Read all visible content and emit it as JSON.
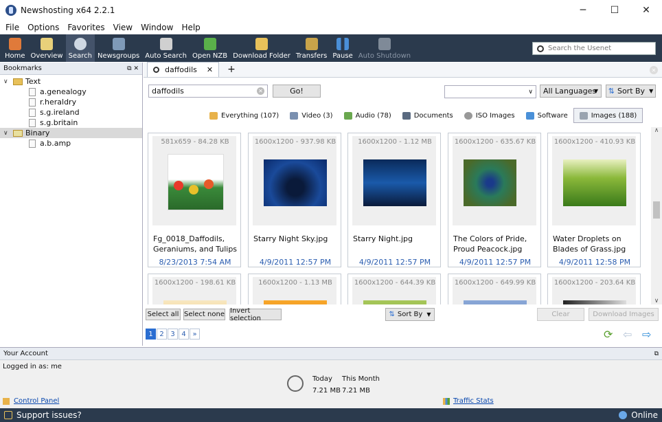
{
  "window": {
    "title": "Newshosting x64 2.2.1",
    "minimize": "─",
    "maximize": "☐",
    "close": "✕"
  },
  "menu": [
    "File",
    "Options",
    "Favorites",
    "View",
    "Window",
    "Help"
  ],
  "toolbar": [
    {
      "label": "Home",
      "icon": "home-icon",
      "color": "#e07a3a"
    },
    {
      "label": "Overview",
      "icon": "overview-icon",
      "color": "#e8d07a"
    },
    {
      "label": "Search",
      "icon": "search-icon",
      "color": "#cfd8e3"
    },
    {
      "label": "Newsgroups",
      "icon": "newsgroups-icon",
      "color": "#7f9ab8"
    },
    {
      "label": "Auto Search",
      "icon": "auto-search-icon",
      "color": "#d0d0d0"
    },
    {
      "label": "Open NZB",
      "icon": "open-nzb-icon",
      "color": "#5ab04a"
    },
    {
      "label": "Download Folder",
      "icon": "download-folder-icon",
      "color": "#e8c15a"
    },
    {
      "label": "Transfers",
      "icon": "transfers-icon",
      "color": "#c9a44a"
    },
    {
      "label": "Pause",
      "icon": "pause-icon",
      "color": "#4a8fd8"
    },
    {
      "label": "Auto Shutdown",
      "icon": "auto-shutdown-icon",
      "color": "#7f8a98"
    }
  ],
  "search_usenet": {
    "placeholder": "Search the Usenet"
  },
  "bookmarks": {
    "title": "Bookmarks",
    "groups": [
      {
        "label": "Text",
        "items": [
          "a.genealogy",
          "r.heraldry",
          "s.g.ireland",
          "s.g.britain"
        ]
      },
      {
        "label": "Binary",
        "items": [
          "a.b.amp"
        ]
      }
    ]
  },
  "tab": {
    "label": "daffodils",
    "close": "✕",
    "add": "+"
  },
  "query": {
    "value": "daffodils",
    "go": "Go!"
  },
  "language": "All Languages",
  "sort_label": "Sort By",
  "filters": [
    {
      "label": "Everything (107)",
      "color": "#e8b24a"
    },
    {
      "label": "Video (3)",
      "color": "#7a90b0"
    },
    {
      "label": "Audio (78)",
      "color": "#6aa84f"
    },
    {
      "label": "Documents",
      "color": "#5a6a80"
    },
    {
      "label": "ISO Images",
      "color": "#999999"
    },
    {
      "label": "Software",
      "color": "#4a90d8"
    },
    {
      "label": "Images (188)",
      "color": "#9aa4b0"
    }
  ],
  "results": [
    {
      "dim": "581x659 - 84.28 KB",
      "name": "Fg_0018_Daffodils, Geraniums, and Tulips",
      "date": "8/23/2013 7:54 AM"
    },
    {
      "dim": "1600x1200 - 937.98 KB",
      "name": "Starry Night Sky.jpg",
      "date": "4/9/2011 12:57 PM"
    },
    {
      "dim": "1600x1200 - 1.12 MB",
      "name": "Starry Night.jpg",
      "date": "4/9/2011 12:57 PM"
    },
    {
      "dim": "1600x1200 - 635.67 KB",
      "name": "The Colors of Pride, Proud Peacock.jpg",
      "date": "4/9/2011 12:57 PM"
    },
    {
      "dim": "1600x1200 - 410.93 KB",
      "name": "Water Droplets on Blades of Grass.jpg",
      "date": "4/9/2011 12:58 PM"
    },
    {
      "dim": "1600x1200 - 198.61 KB",
      "name": "",
      "date": ""
    },
    {
      "dim": "1600x1200 - 1.13 MB",
      "name": "",
      "date": ""
    },
    {
      "dim": "1600x1200 - 644.39 KB",
      "name": "",
      "date": ""
    },
    {
      "dim": "1600x1200 - 649.99 KB",
      "name": "",
      "date": ""
    },
    {
      "dim": "1600x1200 - 203.64 KB",
      "name": "",
      "date": ""
    }
  ],
  "actions": {
    "select_all": "Select all",
    "select_none": "Select none",
    "invert": "Invert selection",
    "sort": "Sort By",
    "clear": "Clear",
    "download": "Download Images"
  },
  "pages": [
    "1",
    "2",
    "3",
    "4",
    "»"
  ],
  "account": {
    "title": "Your Account",
    "logged_in": "Logged in as: me",
    "control_panel": "Control Panel",
    "traffic_stats": "Traffic Stats",
    "today_label": "Today",
    "today_value": "7.21 MB",
    "month_label": "This Month",
    "month_value": "7.21 MB"
  },
  "status": {
    "support": "Support issues?",
    "online": "Online"
  }
}
